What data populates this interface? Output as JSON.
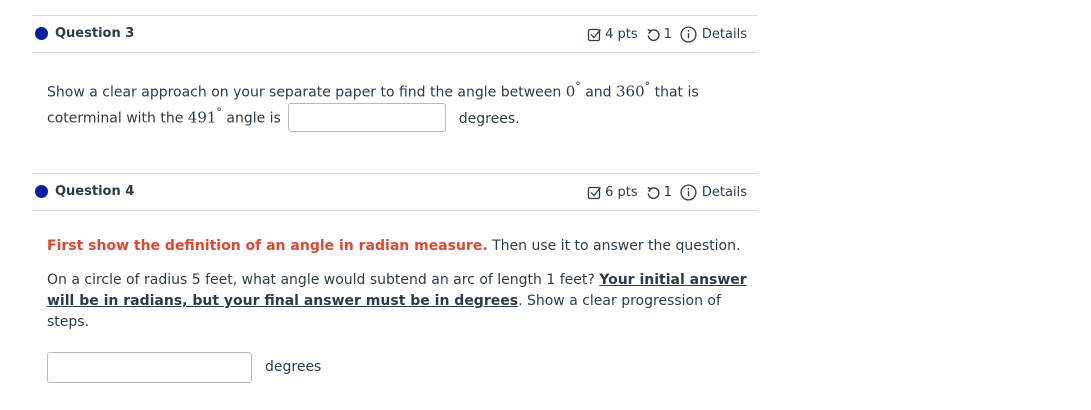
{
  "question3": {
    "title": "Question 3",
    "points": "4 pts",
    "attempts": "1",
    "details": "Details",
    "line1_pre": "Show a clear approach on your separate paper to find the angle between ",
    "val_a": "0",
    "deg_a": "°",
    "and_text": " and ",
    "val_b": "360",
    "deg_b": "°",
    "line1_post": " that is",
    "line2_pre": "coterminal with the ",
    "val_c": "491",
    "deg_c": "°",
    "line2_post": " angle is",
    "input_value": "",
    "unit": "degrees."
  },
  "question4": {
    "title": "Question 4",
    "points": "6 pts",
    "attempts": "1",
    "details": "Details",
    "instruction_red": "First show the definition of an angle in radian measure.",
    "instruction_rest": " Then use it to answer the question.",
    "prompt_pre": "On a circle of radius 5 feet, what angle would subtend an arc of length 1 feet? ",
    "prompt_ul_1": "Your initial answer",
    "prompt_ul_2": "will be in radians, but your final answer must be in degrees",
    "prompt_post": ".  Show a clear progression of steps.",
    "input_value": "",
    "unit": "degrees"
  },
  "colors": {
    "question_dot": "#0b1f9e",
    "highlight_red": "#e0472f",
    "text": "#2d3b45",
    "divider": "#d7dadd"
  },
  "icons": [
    "points-checkbox-icon",
    "retry-icon",
    "info-icon"
  ]
}
